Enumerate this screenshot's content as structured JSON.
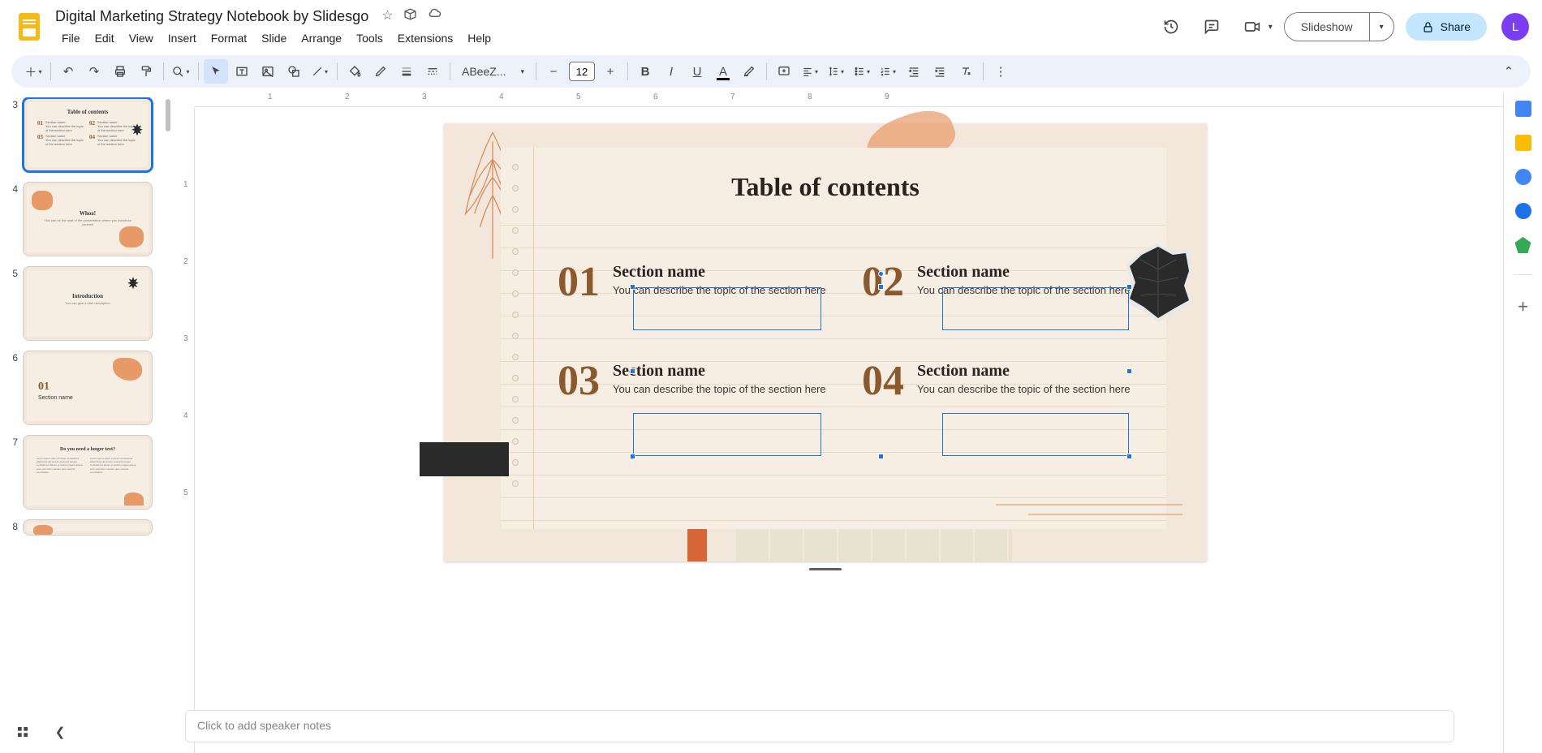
{
  "header": {
    "doc_title": "Digital Marketing Strategy Notebook by Slidesgo",
    "slideshow_label": "Slideshow",
    "share_label": "Share",
    "avatar_letter": "L"
  },
  "menu": [
    "File",
    "Edit",
    "View",
    "Insert",
    "Format",
    "Slide",
    "Arrange",
    "Tools",
    "Extensions",
    "Help"
  ],
  "toolbar": {
    "font_name": "ABeeZ...",
    "font_size": "12"
  },
  "notes": {
    "placeholder": "Click to add speaker notes"
  },
  "slide": {
    "title": "Table of contents",
    "toc": [
      {
        "num": "01",
        "name": "Section name",
        "desc": "You can describe the topic of the section here"
      },
      {
        "num": "02",
        "name": "Section name",
        "desc": "You can describe the topic of the section here"
      },
      {
        "num": "03",
        "name": "Section name",
        "desc": "You can describe the topic of the section here"
      },
      {
        "num": "04",
        "name": "Section name",
        "desc": "You can describe the topic of the section here"
      }
    ]
  },
  "thumbs": [
    {
      "n": "3",
      "title": "Table of contents",
      "active": true
    },
    {
      "n": "4",
      "title": "Whoa!",
      "subtitle": "This can be the start of the presentation where you introduce yourself"
    },
    {
      "n": "5",
      "title": "Introduction",
      "subtitle": "You can give a brief description"
    },
    {
      "n": "6",
      "title": "Section name",
      "num": "01"
    },
    {
      "n": "7",
      "title": "Do you need a longer text?"
    },
    {
      "n": "8",
      "title": ""
    }
  ],
  "ruler_h": [
    "1",
    "2",
    "3",
    "4",
    "5",
    "6",
    "7",
    "8",
    "9"
  ],
  "ruler_v": [
    "1",
    "2",
    "3",
    "4",
    "5"
  ]
}
